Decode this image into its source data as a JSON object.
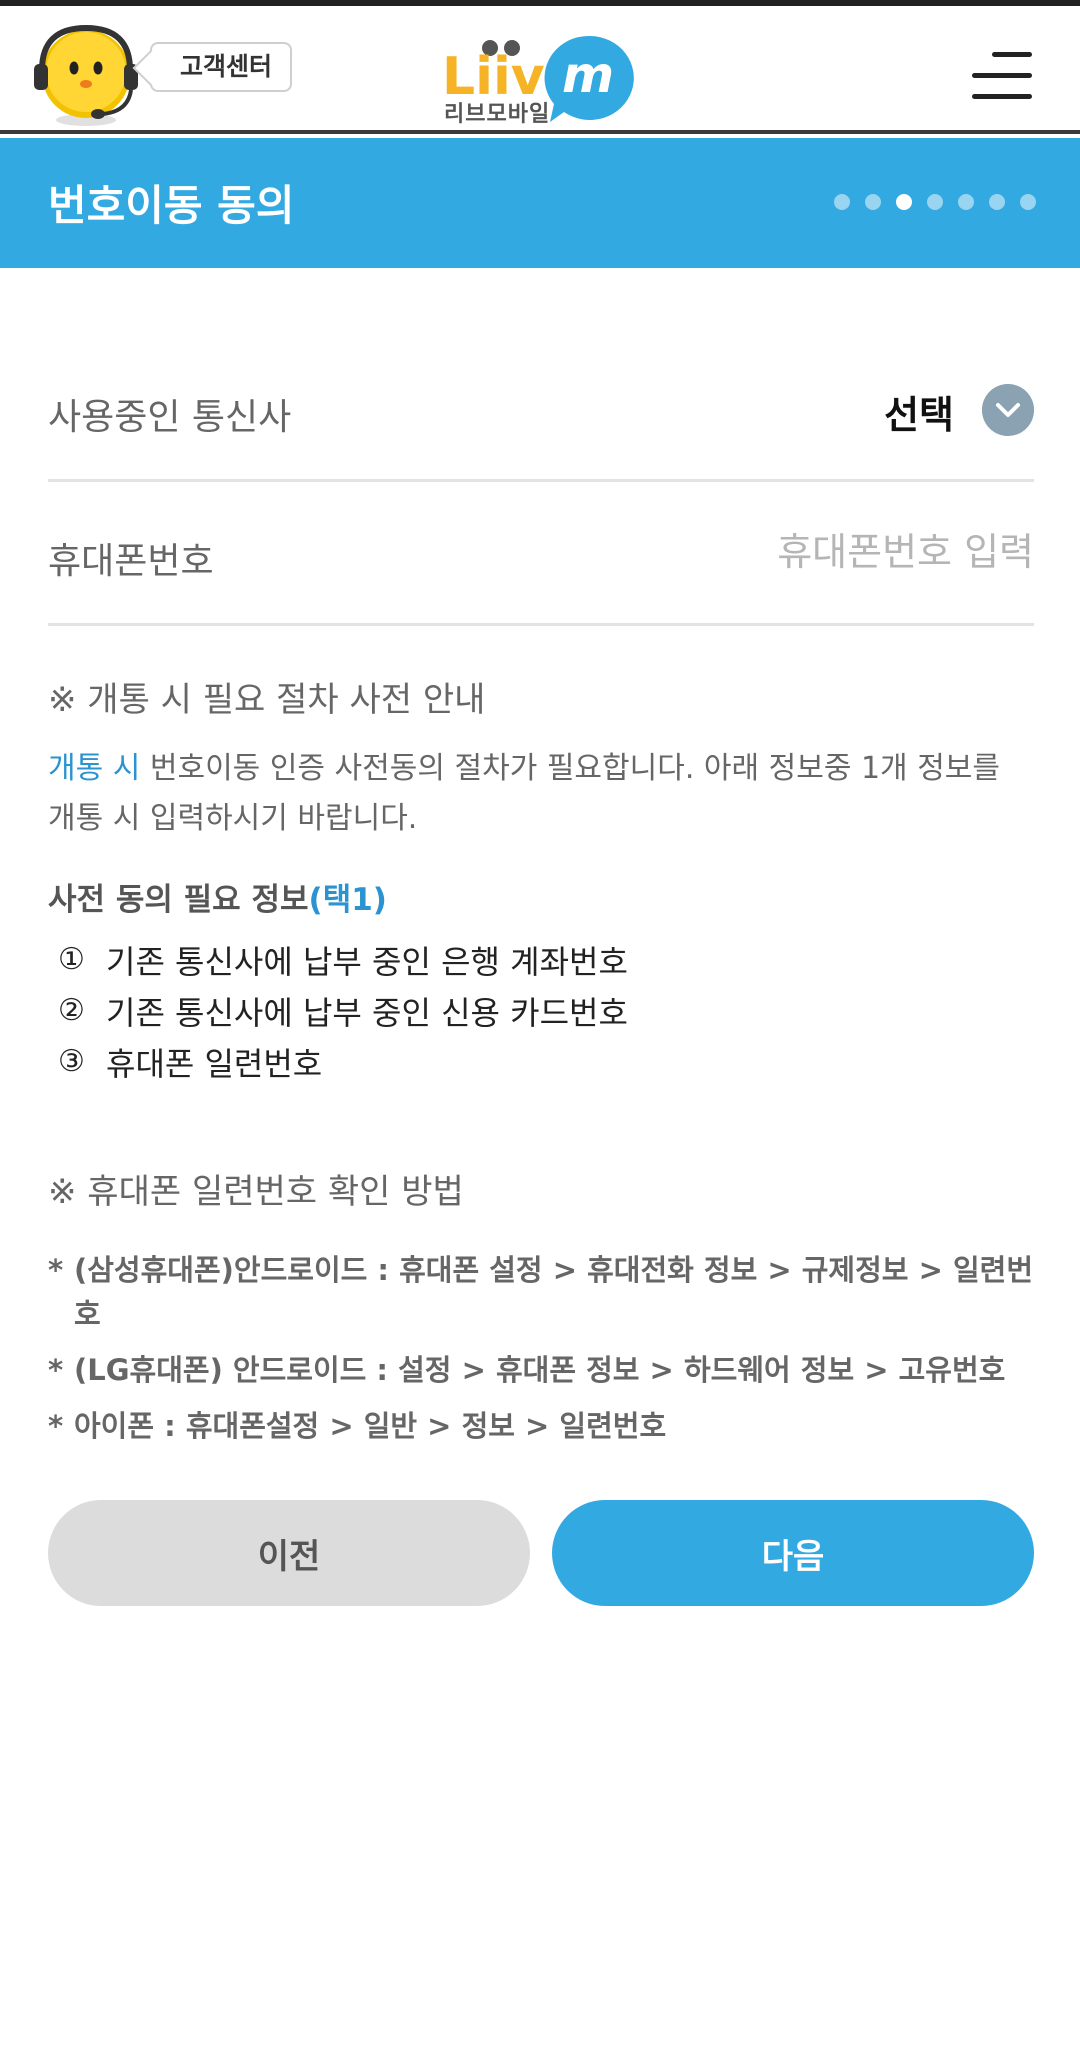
{
  "header": {
    "customer_center": "고객센터",
    "logo_text": "Liiv",
    "logo_sub": "리브모바일"
  },
  "title": {
    "text": "번호이동 동의",
    "steps_total": 7,
    "steps_current": 3
  },
  "form": {
    "carrier_label": "사용중인 통신사",
    "carrier_value": "선택",
    "phone_label": "휴대폰번호",
    "phone_placeholder": "휴대폰번호 입력",
    "phone_value": ""
  },
  "notice1": {
    "heading": "※ 개통 시 필요 절차 사전 안내",
    "desc_highlight": "개통 시",
    "desc_rest": " 번호이동 인증 사전동의 절차가 필요합니다. 아래 정보중 1개 정보를 개통 시 입력하시기 바랍니다.",
    "subhead": "사전 동의 필요 정보",
    "subhead_highlight": "(택1)",
    "items": [
      {
        "num": "①",
        "text": "기존 통신사에 납부 중인 은행 계좌번호"
      },
      {
        "num": "②",
        "text": "기존 통신사에 납부 중인 신용 카드번호"
      },
      {
        "num": "③",
        "text": "휴대폰 일련번호"
      }
    ]
  },
  "notice2": {
    "heading": "※ 휴대폰 일련번호 확인 방법",
    "bullets": [
      "(삼성휴대폰)안드로이드 : 휴대폰 설정 > 휴대전화 정보 > 규제정보 > 일련번호",
      "(LG휴대폰) 안드로이드 : 설정 > 휴대폰 정보 > 하드웨어 정보 > 고유번호",
      "아이폰 : 휴대폰설정 > 일반 > 정보 > 일련번호"
    ]
  },
  "buttons": {
    "prev": "이전",
    "next": "다음"
  },
  "colors": {
    "primary": "#33a9e2",
    "highlight": "#2b93cf",
    "logo_yellow": "#f5b325"
  }
}
